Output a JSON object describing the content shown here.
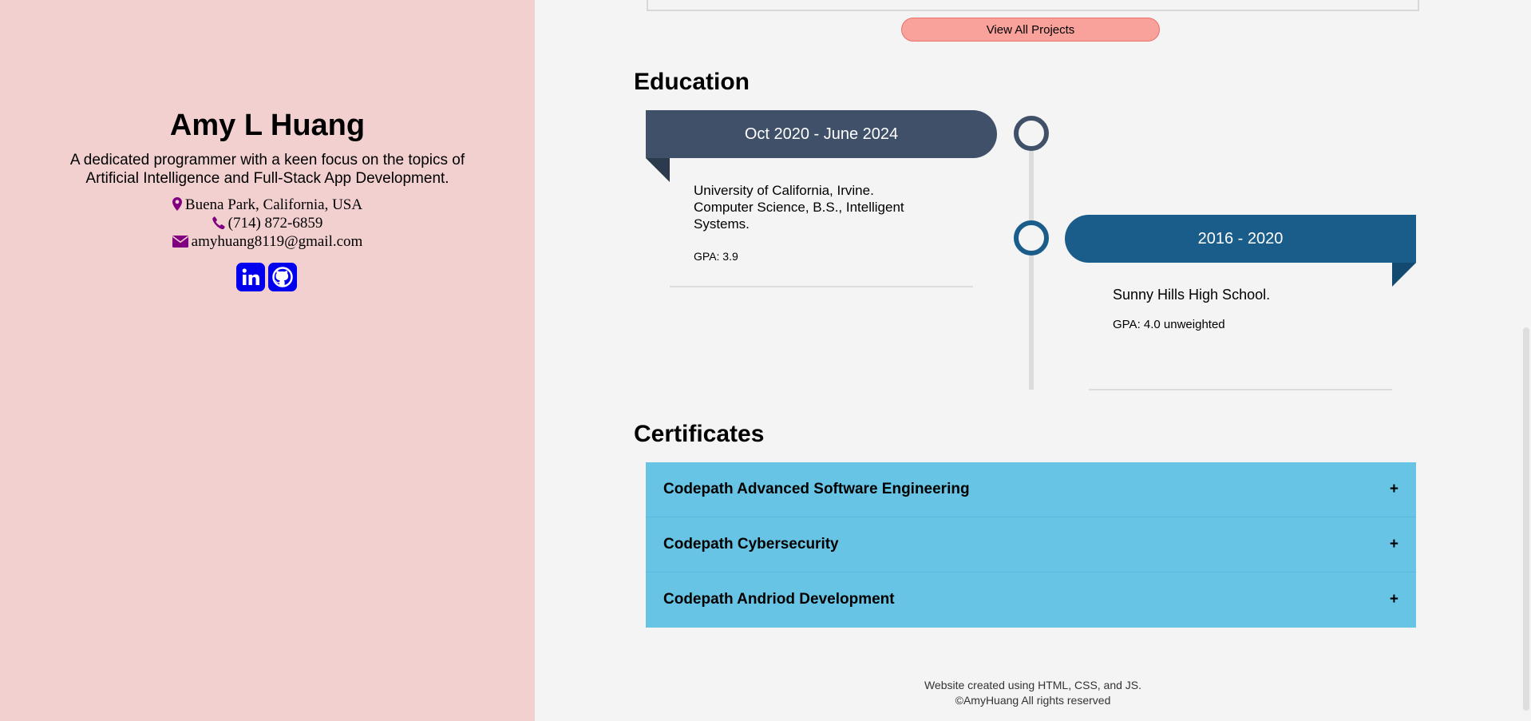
{
  "sidebar": {
    "name": "Amy L Huang",
    "tagline": "A dedicated programmer with a keen focus on the topics of Artificial Intelligence and Full-Stack App Development.",
    "location": "Buena Park, California, USA",
    "phone": "(714) 872-6859",
    "email": "amyhuang8119@gmail.com",
    "socials": [
      {
        "icon": "linkedin-icon"
      },
      {
        "icon": "github-icon"
      }
    ]
  },
  "projects": {
    "view_all_label": "View All Projects"
  },
  "education": {
    "title": "Education",
    "entries": [
      {
        "dates": "Oct 2020 - June 2024",
        "school": "University of California, Irvine. Computer Science, B.S., Intelligent Systems.",
        "gpa": "GPA: 3.9",
        "color": "#3f5068"
      },
      {
        "dates": "2016 - 2020",
        "school": "Sunny Hills High School.",
        "gpa": "GPA: 4.0 unweighted",
        "color": "#1b5d8a"
      }
    ]
  },
  "certificates": {
    "title": "Certificates",
    "items": [
      {
        "label": "Codepath Advanced Software Engineering",
        "toggle": "+"
      },
      {
        "label": "Codepath Cybersecurity",
        "toggle": "+"
      },
      {
        "label": "Codepath Andriod Development",
        "toggle": "+"
      }
    ]
  },
  "footer": {
    "line1": "Website created using HTML, CSS, and JS.",
    "line2": "©AmyHuang All rights reserved"
  },
  "colors": {
    "sidebar_bg": "#f2d0d0",
    "accent_icon": "#800080",
    "social_bg": "#0000ee",
    "button_bg": "#f9a19b",
    "accordion_bg": "#67c4e4"
  }
}
